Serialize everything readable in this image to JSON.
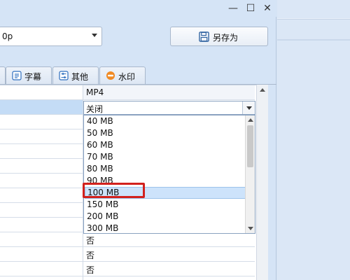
{
  "window": {
    "minimize_glyph": "—",
    "maximize_glyph": "☐",
    "close_glyph": "✕"
  },
  "toolbar": {
    "resolution_value": "0p",
    "save_as_label": "另存为",
    "save_icon": "floppy-disk-icon"
  },
  "tabs": [
    {
      "label": "字幕",
      "icon": "subtitle-icon"
    },
    {
      "label": "其他",
      "icon": "sliders-icon"
    },
    {
      "label": "水印",
      "icon": "watermark-icon"
    }
  ],
  "grid": {
    "column_header": "MP4",
    "split_value": "关闭",
    "bottom_values": [
      "否",
      "否",
      "否"
    ]
  },
  "dropdown": {
    "options": [
      "40 MB",
      "50 MB",
      "60 MB",
      "70 MB",
      "80 MB",
      "90 MB",
      "100 MB",
      "150 MB",
      "200 MB",
      "300 MB"
    ],
    "highlighted": "100 MB"
  },
  "colors": {
    "highlight_box": "#d2211d",
    "selected_row": "#c4dcf6"
  }
}
